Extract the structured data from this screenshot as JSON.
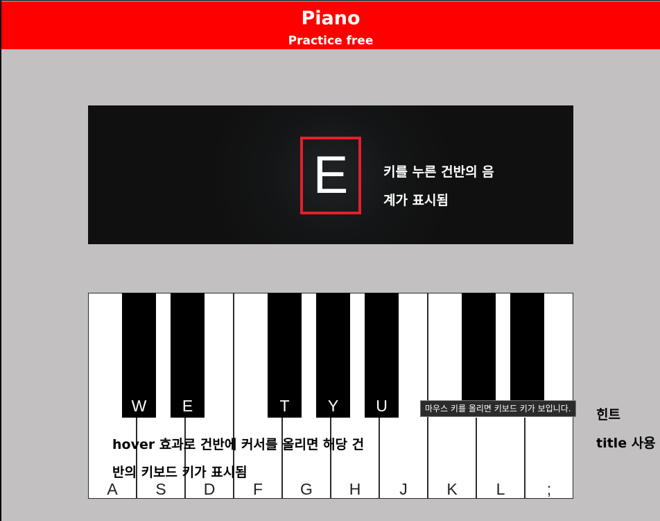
{
  "header": {
    "title": "Piano",
    "subtitle": "Practice free",
    "background": "#ff0000"
  },
  "display": {
    "current_note": "E",
    "caption": "키를 누른 건반의 음\n계가 표시됨",
    "highlight_color": "#e3202b"
  },
  "keyboard": {
    "white_keys": [
      {
        "label": "A"
      },
      {
        "label": "S"
      },
      {
        "label": "D"
      },
      {
        "label": "F"
      },
      {
        "label": "G"
      },
      {
        "label": "H"
      },
      {
        "label": "J"
      },
      {
        "label": "K"
      },
      {
        "label": "L"
      },
      {
        "label": ";"
      }
    ],
    "black_keys": [
      {
        "label": "W"
      },
      {
        "label": "E"
      },
      {
        "label": "T"
      },
      {
        "label": "Y"
      },
      {
        "label": "U"
      },
      {
        "label": ""
      },
      {
        "label": ""
      }
    ]
  },
  "annotations": {
    "hover_caption": "hover 효과로 건반에 커서를 올리면 해당 건\n반의 키보드 키가 표시됨",
    "tooltip": "마우스 키를 올리면 키보드 키가 보입니다.",
    "hint": "힌트\ntitle 사용"
  }
}
